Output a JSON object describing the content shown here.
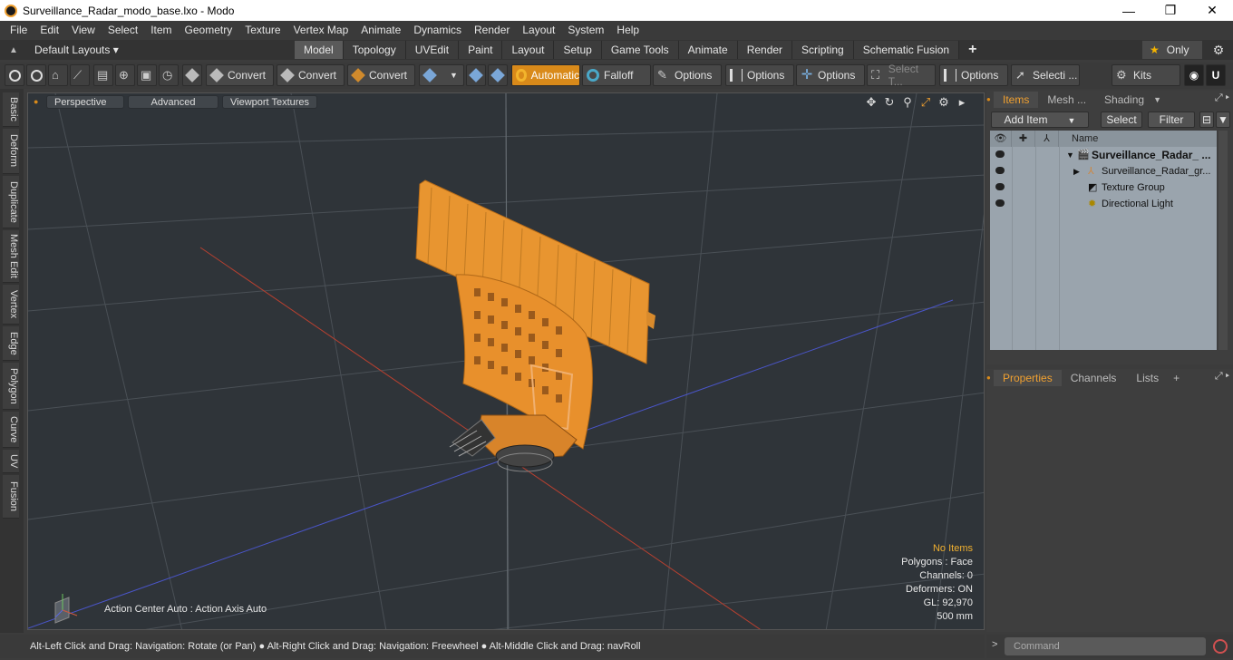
{
  "window": {
    "title": "Surveillance_Radar_modo_base.lxo - Modo",
    "minimize": "—",
    "maximize": "❐",
    "close": "✕"
  },
  "menu": [
    "File",
    "Edit",
    "View",
    "Select",
    "Item",
    "Geometry",
    "Texture",
    "Vertex Map",
    "Animate",
    "Dynamics",
    "Render",
    "Layout",
    "System",
    "Help"
  ],
  "layouts": {
    "label": "Default Layouts ▾",
    "tabs": [
      "Model",
      "Topology",
      "UVEdit",
      "Paint",
      "Layout",
      "Setup",
      "Game Tools",
      "Animate",
      "Render",
      "Scripting",
      "Schematic Fusion"
    ],
    "active_tab": "Model",
    "only": "Only"
  },
  "toolbar": {
    "convert1": "Convert",
    "convert2": "Convert",
    "convert3": "Convert",
    "automatic": "Automatic",
    "falloff": "Falloff",
    "options1": "Options",
    "options2": "Options",
    "options3": "Options",
    "select_t": "Select T...",
    "options4": "Options",
    "selecti": "Selecti ...",
    "kits": "Kits"
  },
  "sidetabs": [
    "Basic",
    "Deform",
    "Duplicate",
    "Mesh Edit",
    "Vertex",
    "Edge",
    "Polygon",
    "Curve",
    "UV",
    "Fusion"
  ],
  "viewport": {
    "perspective": "Perspective",
    "advanced": "Advanced",
    "textures": "Viewport Textures",
    "no_items": "No Items",
    "polygons": "Polygons : Face",
    "channels": "Channels: 0",
    "deformers": "Deformers: ON",
    "gl": "GL: 92,970",
    "scale": "500 mm",
    "action": "Action Center Auto : Action Axis Auto"
  },
  "status": "Alt-Left Click and Drag: Navigation: Rotate (or Pan) ● Alt-Right Click and Drag: Navigation: Freewheel ● Alt-Middle Click and Drag: navRoll",
  "command_placeholder": "Command",
  "items_panel": {
    "tabs": [
      "Items",
      "Mesh ...",
      "Shading"
    ],
    "add_item": "Add Item",
    "select": "Select",
    "filter": "Filter",
    "col_name": "Name",
    "rows": [
      {
        "label": "Surveillance_Radar_ ...",
        "bold": true
      },
      {
        "label": "Surveillance_Radar_gr..."
      },
      {
        "label": "Texture Group"
      },
      {
        "label": "Directional Light"
      }
    ]
  },
  "props_panel": {
    "tabs": [
      "Properties",
      "Channels",
      "Lists"
    ],
    "plus": "+"
  }
}
